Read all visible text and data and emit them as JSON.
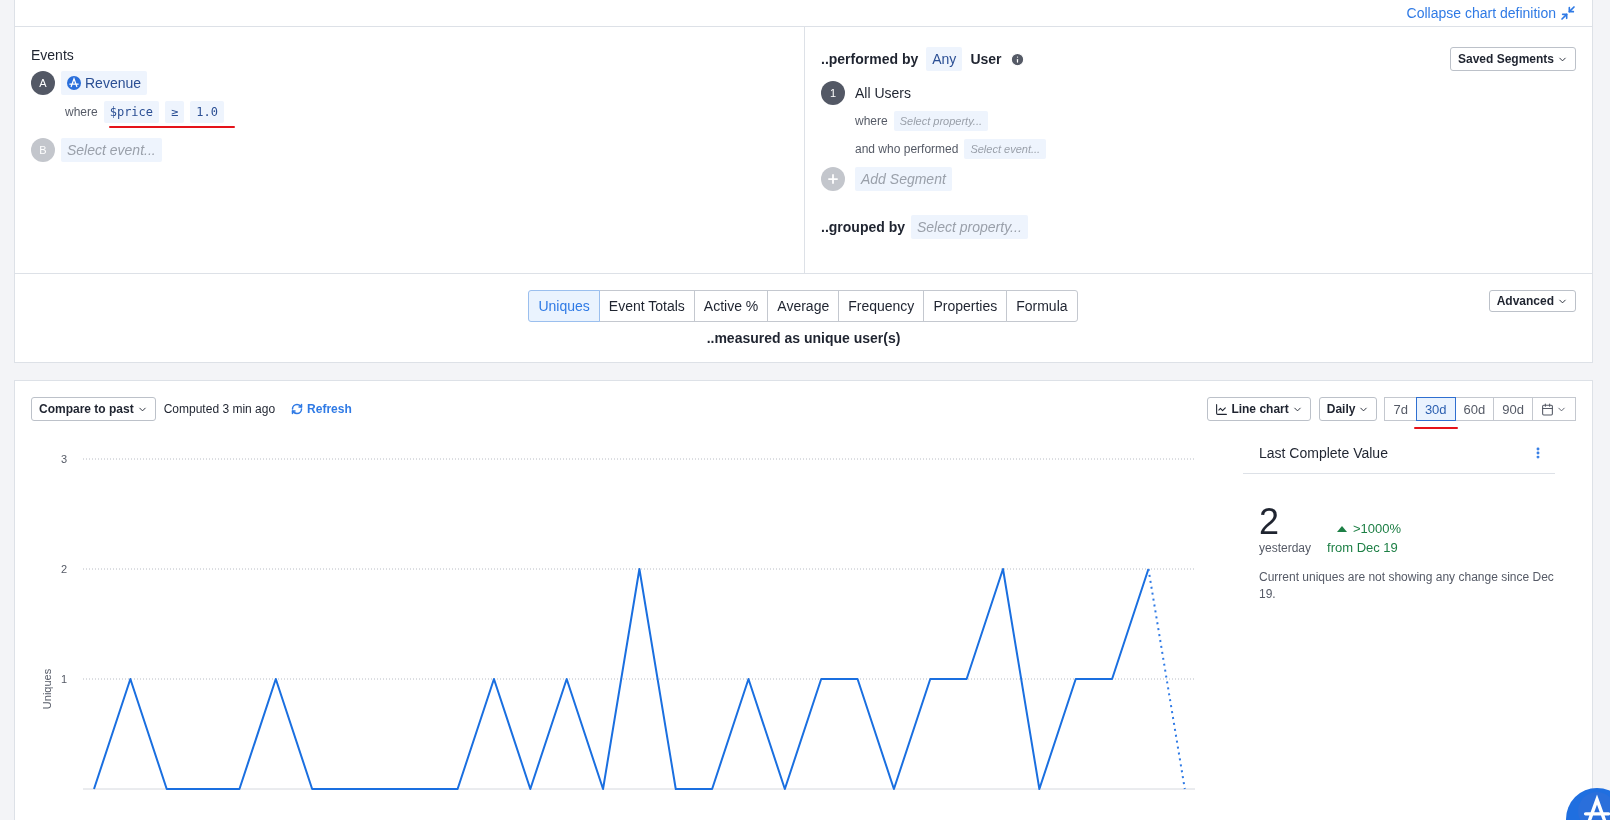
{
  "header": {
    "collapse_link": "Collapse chart definition"
  },
  "events": {
    "title": "Events",
    "items": [
      {
        "letter": "A",
        "kind": "event",
        "name": "Revenue",
        "filters": [
          {
            "label": "where",
            "chips": [
              "$price",
              "≥",
              "1.0"
            ],
            "underlined": true
          }
        ]
      },
      {
        "letter": "B",
        "kind": "placeholder",
        "name": "Select event..."
      }
    ]
  },
  "segments": {
    "performed_label": "..performed by",
    "any": "Any",
    "user": "User",
    "saved_segments": "Saved Segments",
    "items": [
      {
        "number": "1",
        "name": "All Users",
        "where_label": "where",
        "where_placeholder": "Select property...",
        "performed_label": "and who performed",
        "performed_placeholder": "Select event..."
      }
    ],
    "add_segment": "Add Segment",
    "grouped_label": "..grouped by",
    "grouped_placeholder": "Select property..."
  },
  "metrics": {
    "tabs": [
      {
        "label": "Uniques",
        "selected": true
      },
      {
        "label": "Event Totals",
        "selected": false
      },
      {
        "label": "Active %",
        "selected": false
      },
      {
        "label": "Average",
        "selected": false
      },
      {
        "label": "Frequency",
        "selected": false
      },
      {
        "label": "Properties",
        "selected": false
      },
      {
        "label": "Formula",
        "selected": false
      }
    ],
    "caption": "..measured as unique user(s)",
    "advanced": "Advanced"
  },
  "toolbar": {
    "compare": "Compare to past",
    "computed": "Computed 3 min ago",
    "refresh": "Refresh",
    "chart_type": "Line chart",
    "interval": "Daily",
    "ranges": [
      {
        "label": "7d",
        "selected": false,
        "underlined": false
      },
      {
        "label": "30d",
        "selected": true,
        "underlined": true
      },
      {
        "label": "60d",
        "selected": false,
        "underlined": false
      },
      {
        "label": "90d",
        "selected": false,
        "underlined": false
      }
    ]
  },
  "chart": {
    "chart_data": {
      "type": "line",
      "ylabel": "Uniques",
      "yticks": [
        1,
        2,
        3
      ],
      "ylim": [
        0,
        3
      ],
      "series": [
        {
          "color": "#1a6fe0",
          "line_style": "solid",
          "values": [
            0,
            1,
            0,
            0,
            0,
            1,
            0,
            0,
            0,
            0,
            0,
            1,
            0,
            1,
            0,
            2,
            0,
            0,
            1,
            0,
            1,
            1,
            0,
            1,
            1,
            2,
            0,
            1,
            1,
            2,
            null
          ]
        },
        {
          "color": "#2f7ae5",
          "line_style": "dotted",
          "values": [
            null,
            null,
            null,
            null,
            null,
            null,
            null,
            null,
            null,
            null,
            null,
            null,
            null,
            null,
            null,
            null,
            null,
            null,
            null,
            null,
            null,
            null,
            null,
            null,
            null,
            null,
            null,
            null,
            null,
            2,
            0
          ]
        }
      ]
    }
  },
  "summary": {
    "title": "Last Complete Value",
    "value": "2",
    "value_label": "yesterday",
    "change": ">1000%",
    "change_label": "from Dec 19",
    "note": "Current uniques are not showing any change since Dec 19."
  }
}
